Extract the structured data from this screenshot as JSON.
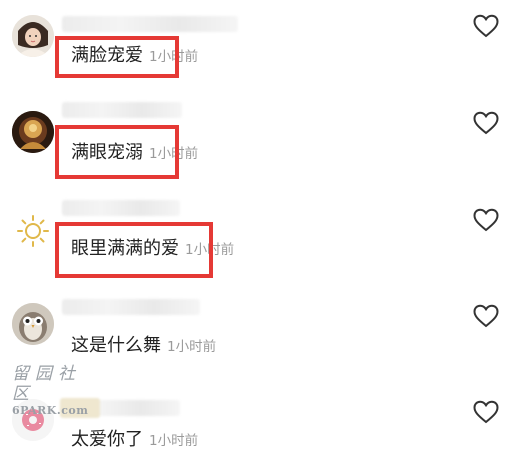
{
  "comments": [
    {
      "text": "满脸宠爱",
      "time": "1小时前",
      "avatar": "user-avatar",
      "highlighted": true
    },
    {
      "text": "满眼宠溺",
      "time": "1小时前",
      "avatar": "user-avatar",
      "highlighted": true
    },
    {
      "text": "眼里满满的爱",
      "time": "1小时前",
      "avatar": "sun-avatar",
      "highlighted": true
    },
    {
      "text": "这是什么舞",
      "time": "1小时前",
      "avatar": "owl-avatar",
      "highlighted": false
    },
    {
      "text": "太爱你了",
      "time": "1小时前",
      "avatar": "donut-avatar",
      "highlighted": false
    }
  ],
  "watermark": {
    "cn": "留园社区",
    "en": "6PARK.com"
  },
  "colors": {
    "highlight": "#e53935",
    "time": "#9a9a9a",
    "text": "#222222"
  },
  "icons": {
    "like": "heart-outline-icon"
  }
}
